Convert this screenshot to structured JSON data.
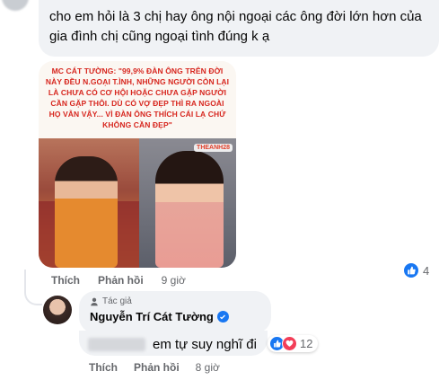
{
  "comment1": {
    "text": "cho em hỏi là 3 chị hay ông nội ngoại các ông đời lớn hơn của gia đình chị cũng ngoại tình đúng k ạ",
    "image_quote": "MC CÁT TƯỜNG: \"99,9% ĐÀN ÔNG TRÊN ĐỜI NÀY ĐỀU N.GOẠI T.ÌNH, NHỮNG NGƯỜI CÒN LẠI LÀ CHƯA CÓ CƠ HỘI HOẶC CHƯA GẶP NGƯỜI CẦN GẶP THÔI. DÙ CÓ VỢ ĐẸP THÌ RA NGOÀI HỌ VẪN VẬY... VÌ ĐÀN ÔNG THÍCH CÁI LẠ CHỨ KHÔNG CẦN ĐẸP\"",
    "image_brand": "THEANH28",
    "like_label": "Thích",
    "reply_label": "Phản hồi",
    "time": "9 giờ",
    "reaction_count": "4"
  },
  "reply": {
    "author_tag": "Tác giả",
    "author_name": "Nguyễn Trí Cát Tường",
    "text": "em tự suy nghĩ đi",
    "reaction_count": "12",
    "like_label": "Thích",
    "reply_label": "Phản hồi",
    "time": "8 giờ"
  },
  "colors": {
    "like_blue": "#1877f2",
    "love_red": "#f33e58",
    "quote_red": "#d7261e"
  },
  "icons": [
    "like-icon",
    "love-icon",
    "verified-icon",
    "author-tag-icon"
  ]
}
